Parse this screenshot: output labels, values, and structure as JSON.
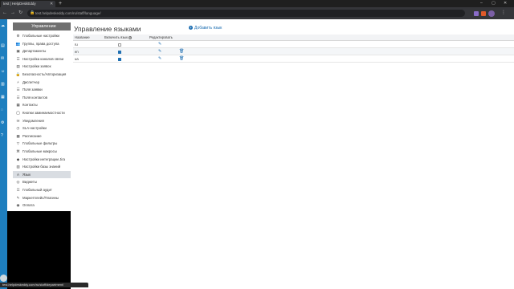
{
  "browser": {
    "tab_title": "test | HelpDeskEddy",
    "address": "test.helpdeskeddy.com/ru/staff/language/",
    "status_url": "test.helpdeskeddy.com/ru/staff/department/"
  },
  "sidebar": {
    "header": "Управление",
    "items": [
      {
        "label": "Глобальные настройки",
        "icon": "gear-icon",
        "glyph": "⚙"
      },
      {
        "label": "Группы, права доступа",
        "icon": "users-icon",
        "glyph": "👥"
      },
      {
        "label": "Департаменты",
        "icon": "sitemap-icon",
        "glyph": "▣"
      },
      {
        "label": "Настройка каналов связи",
        "icon": "channels-icon",
        "glyph": "☰"
      },
      {
        "label": "Настройки заявок",
        "icon": "ticket-icon",
        "glyph": "▤"
      },
      {
        "label": "Безопасность/Авторизация",
        "icon": "lock-icon",
        "glyph": "🔒"
      },
      {
        "label": "Диспетчер",
        "icon": "dispatcher-icon",
        "glyph": "⚡"
      },
      {
        "label": "Поля заявки",
        "icon": "fields-icon",
        "glyph": "☰"
      },
      {
        "label": "Поля контактов",
        "icon": "contact-fields-icon",
        "glyph": "☰"
      },
      {
        "label": "Контакты",
        "icon": "contacts-icon",
        "glyph": "▦"
      },
      {
        "label": "Кнопки заминаемостности",
        "icon": "buttons-icon",
        "glyph": "◯"
      },
      {
        "label": "Уведомления",
        "icon": "bell-icon",
        "glyph": "✉"
      },
      {
        "label": "SLA-настройки",
        "icon": "sla-icon",
        "glyph": "◷"
      },
      {
        "label": "Расписание",
        "icon": "calendar-icon",
        "glyph": "▦"
      },
      {
        "label": "Глобальные фильтры",
        "icon": "filter-icon",
        "glyph": "▽"
      },
      {
        "label": "Глобальные макросы",
        "icon": "macro-icon",
        "glyph": "⌘"
      },
      {
        "label": "Настройки интеграции Jira",
        "icon": "jira-icon",
        "glyph": "◆"
      },
      {
        "label": "Настройки базы знаний",
        "icon": "book-icon",
        "glyph": "▥"
      },
      {
        "label": "Язык",
        "icon": "language-icon",
        "glyph": "A"
      },
      {
        "label": "Виджеты",
        "icon": "widget-icon",
        "glyph": "◎"
      },
      {
        "label": "Глобальный аудит",
        "icon": "audit-icon",
        "glyph": "☰"
      },
      {
        "label": "Маркетплейс/Плагины",
        "icon": "plug-icon",
        "glyph": "✎"
      },
      {
        "label": "Оплата",
        "icon": "payment-icon",
        "glyph": "◉"
      }
    ]
  },
  "main": {
    "title": "Управление языками",
    "add_label": "Добавить язык",
    "columns": {
      "name": "Название",
      "enable": "Включить язык",
      "edit": "Редактировать"
    },
    "rows": [
      {
        "name": "ru",
        "enabled": false,
        "deletable": false
      },
      {
        "name": "en",
        "enabled": true,
        "deletable": true
      },
      {
        "name": "ua",
        "enabled": true,
        "deletable": true
      }
    ]
  },
  "colors": {
    "accent": "#1f6fb2",
    "appbar": "#1e7fbf",
    "sidebar_header": "#6f6f6f"
  }
}
